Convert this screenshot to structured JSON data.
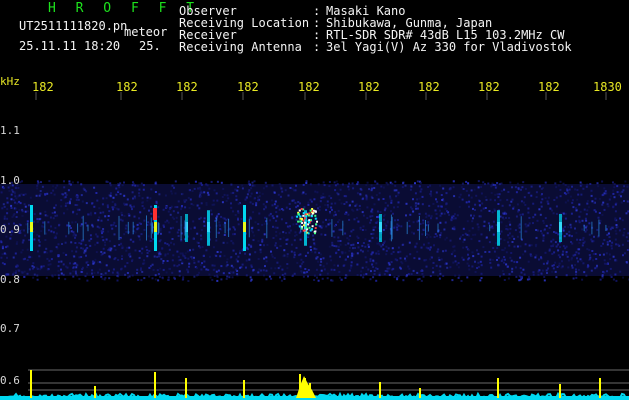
{
  "header": {
    "brand": "H R O F F T",
    "filename": "UT2511111820.pn",
    "kind": "meteor",
    "date_time": "25.11.11 18:20",
    "number": "25."
  },
  "station_info": [
    {
      "label": "Observer",
      "sep": ":",
      "value": "Masaki Kano"
    },
    {
      "label": "Receiving Location",
      "sep": ":",
      "value": "Shibukawa, Gunma, Japan"
    },
    {
      "label": "Receiver",
      "sep": ":",
      "value": "RTL-SDR SDR# 43dB L15 103.2MHz CW"
    },
    {
      "label": "Receiving Antenna",
      "sep": ":",
      "value": "3el Yagi(V) Az 330 for Vladivostok"
    }
  ],
  "axis": {
    "unit_label": "kHz",
    "time_ticks": [
      "182",
      "182",
      "182",
      "182",
      "182",
      "182",
      "182",
      "182",
      "182",
      "1830"
    ],
    "freq_ticks": [
      "1.1",
      "1.0",
      "0.9",
      "0.8",
      "0.7",
      "0.6"
    ]
  },
  "colors": {
    "background": "#000000",
    "brand": "#1de21d",
    "header_text": "#f4f4f4",
    "tick_label": "#e8e824",
    "noise_band": "#1a1f8a",
    "signal_trace": "#00d8f0",
    "meteor_peak": "#ffff00",
    "hot_spot": "#ff3030"
  },
  "plot": {
    "meteor_echoes": [
      {
        "time_label": "182",
        "strength": "strong"
      },
      {
        "time_label": "182",
        "strength": "strong"
      },
      {
        "time_label": "182",
        "strength": "weak"
      },
      {
        "time_label": "182",
        "strength": "medium"
      },
      {
        "time_label": "182",
        "strength": "strong"
      },
      {
        "time_label": "182",
        "strength": "medium"
      },
      {
        "time_label": "182",
        "strength": "weak"
      },
      {
        "time_label": "182",
        "strength": "medium"
      },
      {
        "time_label": "182",
        "strength": "weak"
      }
    ]
  }
}
